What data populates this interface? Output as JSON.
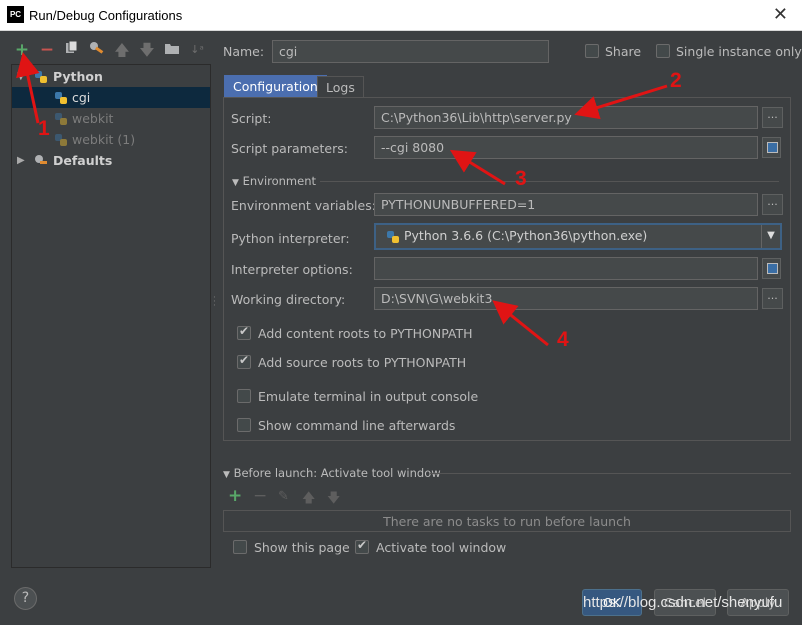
{
  "window": {
    "title": "Run/Debug Configurations",
    "app_icon_text": "PC"
  },
  "toolbar": {
    "icons": [
      "add-icon",
      "remove-icon",
      "copy-icon",
      "wrench-icon",
      "up-arrow-icon",
      "down-arrow-icon",
      "folder-icon",
      "sort-icon"
    ]
  },
  "tree": {
    "items": [
      {
        "label": "Python"
      },
      {
        "label": "cgi"
      },
      {
        "label": "webkit"
      },
      {
        "label": "webkit (1)"
      },
      {
        "label": "Defaults"
      }
    ]
  },
  "name_field": {
    "label": "Name:",
    "value": "cgi"
  },
  "share": {
    "label": "Share"
  },
  "single_instance": {
    "label": "Single instance only"
  },
  "tabs": [
    {
      "label": "Configuration"
    },
    {
      "label": "Logs"
    }
  ],
  "config": {
    "script": {
      "label": "Script:",
      "value": "C:\\Python36\\Lib\\http\\server.py"
    },
    "script_params": {
      "label": "Script parameters:",
      "value": "--cgi 8080"
    },
    "environment_section": "Environment",
    "env_vars": {
      "label": "Environment variables:",
      "value": "PYTHONUNBUFFERED=1"
    },
    "interpreter": {
      "label": "Python interpreter:",
      "value": "Python 3.6.6 (C:\\Python36\\python.exe)"
    },
    "interp_options": {
      "label": "Interpreter options:",
      "value": ""
    },
    "working_dir": {
      "label": "Working directory:",
      "value": "D:\\SVN\\G\\webkit3"
    },
    "checkboxes": [
      {
        "label": "Add content roots to PYTHONPATH",
        "checked": true
      },
      {
        "label": "Add source roots to PYTHONPATH",
        "checked": true
      },
      {
        "label": "Emulate terminal in output console",
        "checked": false
      },
      {
        "label": "Show command line afterwards",
        "checked": false
      }
    ]
  },
  "before_launch": {
    "label": "Before launch: Activate tool window",
    "empty_text": "There are no tasks to run before launch",
    "show_page": {
      "label": "Show this page",
      "checked": false
    },
    "activate_tool": {
      "label": "Activate tool window",
      "checked": true
    }
  },
  "buttons": {
    "ok": "OK",
    "cancel": "Cancel",
    "apply": "Apply"
  },
  "annotations": [
    "1",
    "2",
    "3",
    "4"
  ],
  "watermark": "https://blog.csdn.net/shenyufu",
  "colors": {
    "annotation": "#e01414",
    "selected": "#0d293e",
    "tab_active": "#4b6eaf",
    "add_green": "#59a869",
    "remove_red": "#c75450"
  }
}
